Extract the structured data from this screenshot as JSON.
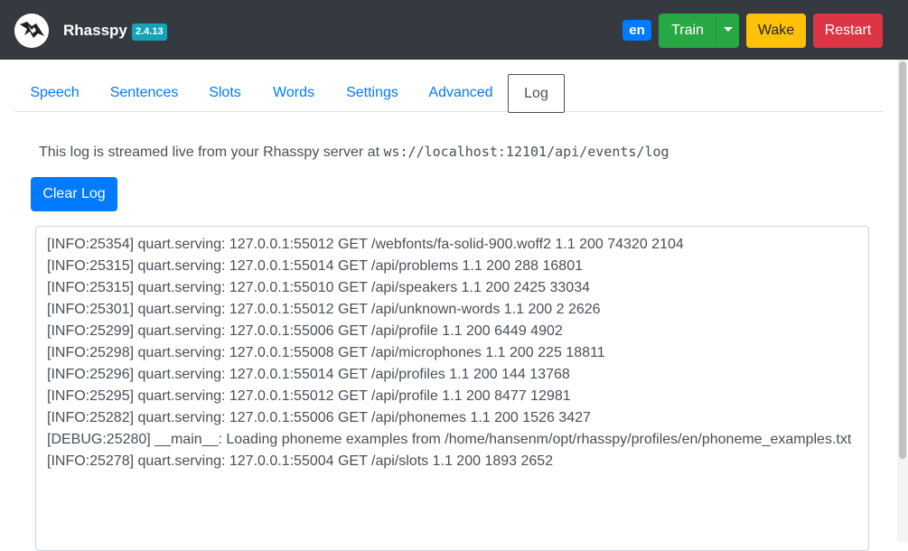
{
  "header": {
    "logo_icon": "rhasspy-logo-icon",
    "brand": "Rhasspy",
    "version": "2.4.13",
    "language": "en",
    "buttons": {
      "train": "Train",
      "wake": "Wake",
      "restart": "Restart"
    },
    "colors": {
      "navbar": "#343a40",
      "train": "#28a745",
      "wake": "#ffc107",
      "restart": "#dc3545",
      "badge": "#17a2b8",
      "language": "#007bff"
    }
  },
  "tabs": [
    {
      "label": "Speech",
      "active": false
    },
    {
      "label": "Sentences",
      "active": false
    },
    {
      "label": "Slots",
      "active": false
    },
    {
      "label": "Words",
      "active": false
    },
    {
      "label": "Settings",
      "active": false
    },
    {
      "label": "Advanced",
      "active": false
    },
    {
      "label": "Log",
      "active": true
    }
  ],
  "log": {
    "info_prefix": "This log is streamed live from your Rhasspy server at",
    "server_url": "ws://localhost:12101/api/events/log",
    "clear_button": "Clear Log",
    "lines": [
      "[INFO:25354] quart.serving: 127.0.0.1:55012 GET /webfonts/fa-solid-900.woff2 1.1 200 74320 2104",
      "[INFO:25315] quart.serving: 127.0.0.1:55014 GET /api/problems 1.1 200 288 16801",
      "[INFO:25315] quart.serving: 127.0.0.1:55010 GET /api/speakers 1.1 200 2425 33034",
      "[INFO:25301] quart.serving: 127.0.0.1:55012 GET /api/unknown-words 1.1 200 2 2626",
      "[INFO:25299] quart.serving: 127.0.0.1:55006 GET /api/profile 1.1 200 6449 4902",
      "[INFO:25298] quart.serving: 127.0.0.1:55008 GET /api/microphones 1.1 200 225 18811",
      "[INFO:25296] quart.serving: 127.0.0.1:55014 GET /api/profiles 1.1 200 144 13768",
      "[INFO:25295] quart.serving: 127.0.0.1:55012 GET /api/profile 1.1 200 8477 12981",
      "[INFO:25282] quart.serving: 127.0.0.1:55006 GET /api/phonemes 1.1 200 1526 3427",
      "[DEBUG:25280] __main__: Loading phoneme examples from /home/hansenm/opt/rhasspy/profiles/en/phoneme_examples.txt",
      "[INFO:25278] quart.serving: 127.0.0.1:55004 GET /api/slots 1.1 200 1893 2652"
    ]
  }
}
